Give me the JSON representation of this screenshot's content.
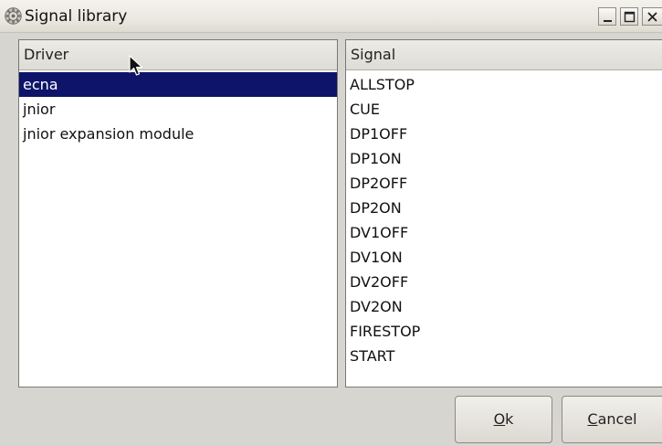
{
  "window": {
    "title": "Signal library",
    "icon": "gear-icon"
  },
  "driver_list": {
    "header": "Driver",
    "items": [
      "ecna",
      "jnior",
      "jnior expansion module"
    ],
    "selected": "ecna"
  },
  "signal_list": {
    "header": "Signal",
    "items": [
      "ALLSTOP",
      "CUE",
      "DP1OFF",
      "DP1ON",
      "DP2OFF",
      "DP2ON",
      "DV1OFF",
      "DV1ON",
      "DV2OFF",
      "DV2ON",
      "FIRESTOP",
      "START"
    ]
  },
  "buttons": {
    "ok_mnemonic": "O",
    "ok_rest": "k",
    "cancel_mnemonic": "C",
    "cancel_rest": "ancel"
  },
  "colors": {
    "selection": "#0d1469",
    "window_bg": "#d7d5cf"
  }
}
